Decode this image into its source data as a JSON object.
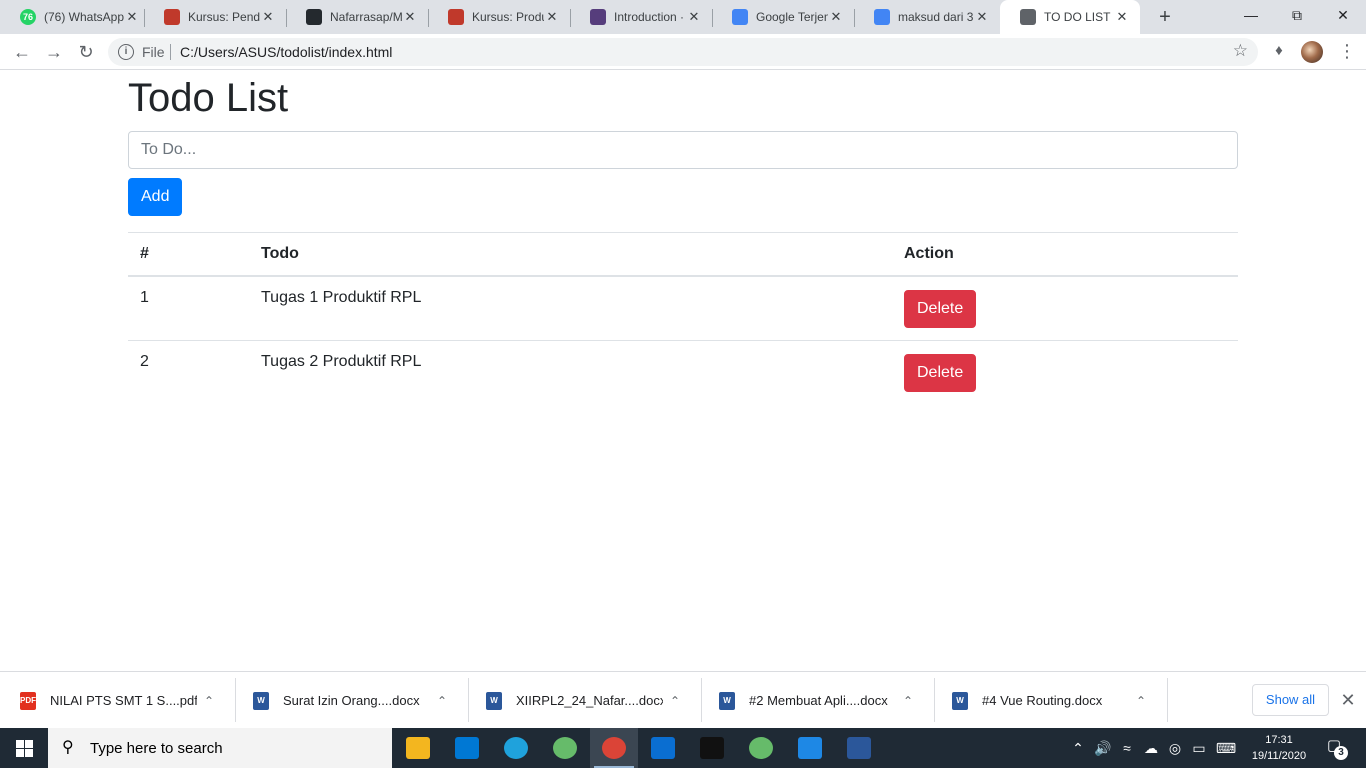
{
  "browser": {
    "tabs": [
      {
        "title": "(76) WhatsApp",
        "icon": "whatsapp-icon",
        "color": "#25d366"
      },
      {
        "title": "Kursus: Pendidi",
        "icon": "moodle-icon",
        "color": "#c0392b"
      },
      {
        "title": "Nafarrasap/Mo",
        "icon": "github-icon",
        "color": "#24292e"
      },
      {
        "title": "Kursus: Produk",
        "icon": "moodle-icon",
        "color": "#c0392b"
      },
      {
        "title": "Introduction · B",
        "icon": "bootstrap-icon",
        "color": "#563d7c"
      },
      {
        "title": "Google Terjem",
        "icon": "google-translate-icon",
        "color": "#4285f4"
      },
      {
        "title": "maksud dari 3",
        "icon": "google-icon",
        "color": "#4285f4"
      },
      {
        "title": "TO DO LIST",
        "icon": "globe-icon",
        "color": "#5f6368"
      }
    ],
    "whatsapp_badge": "76",
    "address": {
      "scheme": "File",
      "url": "C:/Users/ASUS/todolist/index.html"
    }
  },
  "app": {
    "title": "Todo List",
    "input_placeholder": "To Do...",
    "add_label": "Add",
    "table": {
      "headers": [
        "#",
        "Todo",
        "Action"
      ],
      "rows": [
        {
          "num": "1",
          "todo": "Tugas 1 Produktif RPL",
          "action": "Delete"
        },
        {
          "num": "2",
          "todo": "Tugas 2 Produktif RPL",
          "action": "Delete"
        }
      ]
    }
  },
  "downloads": {
    "items": [
      {
        "name": "NILAI PTS SMT 1 S....pdf",
        "type": "PDF",
        "color": "#e2301f"
      },
      {
        "name": "Surat Izin Orang....docx",
        "type": "W",
        "color": "#2b579a"
      },
      {
        "name": "XIIRPL2_24_Nafar....docx",
        "type": "W",
        "color": "#2b579a"
      },
      {
        "name": "#2 Membuat Apli....docx",
        "type": "W",
        "color": "#2b579a"
      },
      {
        "name": "#4 Vue Routing.docx",
        "type": "W",
        "color": "#2b579a"
      }
    ],
    "show_all_label": "Show all"
  },
  "taskbar": {
    "search_placeholder": "Type here to search",
    "apps": [
      {
        "name": "file-explorer-icon",
        "color": "#f3b61f",
        "open": false
      },
      {
        "name": "microsoft-store-icon",
        "color": "#0078d4",
        "open": false
      },
      {
        "name": "edge-icon",
        "color": "#1fa2dc",
        "open": false
      },
      {
        "name": "atom-icon",
        "color": "#66bb6a",
        "open": false
      },
      {
        "name": "chrome-icon",
        "color": "#db4437",
        "open": true
      },
      {
        "name": "mail-icon",
        "color": "#0a6ed1",
        "open": false
      },
      {
        "name": "terminal-icon",
        "color": "#111111",
        "open": false
      },
      {
        "name": "atom-icon",
        "color": "#66bb6a",
        "open": false
      },
      {
        "name": "vscode-icon",
        "color": "#1e88e5",
        "open": false
      },
      {
        "name": "word-icon",
        "color": "#2b579a",
        "open": false
      }
    ],
    "time": "17:31",
    "date": "19/11/2020",
    "notification_count": "3"
  }
}
